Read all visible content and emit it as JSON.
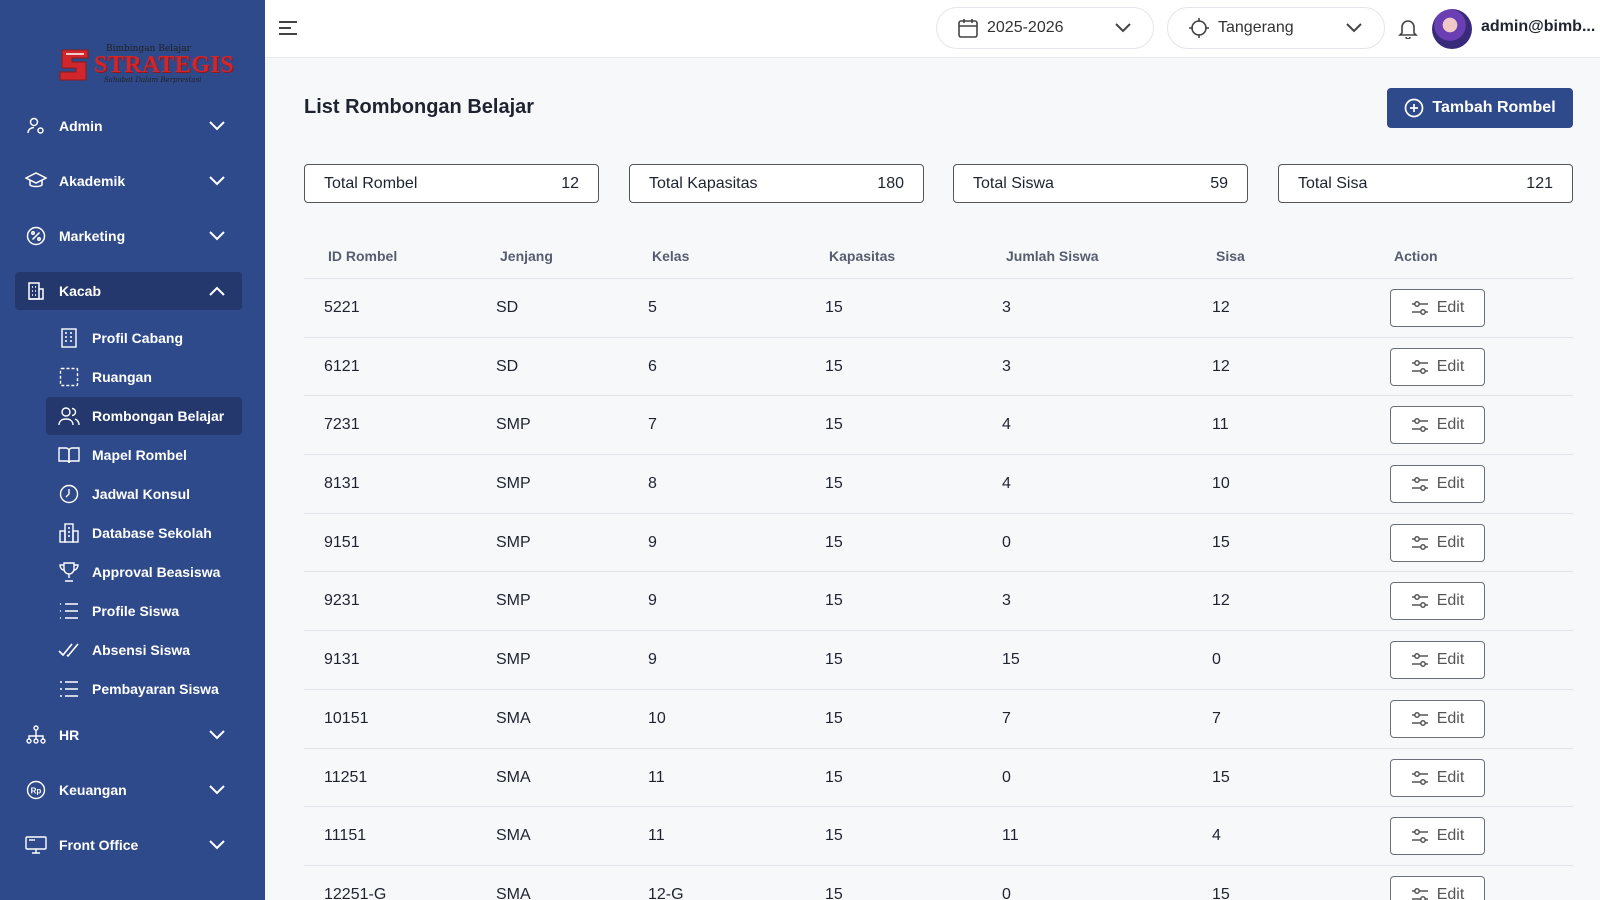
{
  "brand": {
    "tagline": "Bimbingan Belajar",
    "name": "STRATEGIS",
    "slogan": "Sahabat Dalam Berprestasi",
    "colors": {
      "sidebar": "#2f4a8a",
      "active": "#24386d",
      "logo_red": "#d0262c"
    }
  },
  "sidebar": {
    "groups": [
      {
        "label": "Admin",
        "icon": "user-gear-icon",
        "expanded": false
      },
      {
        "label": "Akademik",
        "icon": "graduation-cap-icon",
        "expanded": false
      },
      {
        "label": "Marketing",
        "icon": "percent-badge-icon",
        "expanded": false
      },
      {
        "label": "Kacab",
        "icon": "building-icon",
        "expanded": true
      },
      {
        "label": "HR",
        "icon": "org-chart-icon",
        "expanded": false
      },
      {
        "label": "Keuangan",
        "icon": "rupiah-icon",
        "expanded": false
      },
      {
        "label": "Front Office",
        "icon": "monitor-icon",
        "expanded": false
      }
    ],
    "kacab_items": [
      {
        "label": "Profil Cabang",
        "icon": "building-grid-icon"
      },
      {
        "label": "Ruangan",
        "icon": "dashed-square-icon"
      },
      {
        "label": "Rombongan Belajar",
        "icon": "users-icon",
        "active": true
      },
      {
        "label": "Mapel Rombel",
        "icon": "book-open-icon"
      },
      {
        "label": "Jadwal Konsul",
        "icon": "clock-icon"
      },
      {
        "label": "Database Sekolah",
        "icon": "school-icon"
      },
      {
        "label": "Approval Beasiswa",
        "icon": "trophy-icon"
      },
      {
        "label": "Profile Siswa",
        "icon": "list-icon"
      },
      {
        "label": "Absensi Siswa",
        "icon": "double-check-icon"
      },
      {
        "label": "Pembayaran Siswa",
        "icon": "list-checks-icon"
      }
    ]
  },
  "header": {
    "year": "2025-2026",
    "branch": "Tangerang",
    "user": "admin@bimb..."
  },
  "main": {
    "title": "List Rombongan Belajar",
    "add_button": "Tambah Rombel",
    "stats": [
      {
        "label": "Total Rombel",
        "value": "12"
      },
      {
        "label": "Total Kapasitas",
        "value": "180"
      },
      {
        "label": "Total Siswa",
        "value": "59"
      },
      {
        "label": "Total Sisa",
        "value": "121"
      }
    ],
    "table": {
      "columns": [
        "ID Rombel",
        "Jenjang",
        "Kelas",
        "Kapasitas",
        "Jumlah Siswa",
        "Sisa",
        "Action"
      ],
      "edit_label": "Edit",
      "rows": [
        [
          "5221",
          "SD",
          "5",
          "15",
          "3",
          "12"
        ],
        [
          "6121",
          "SD",
          "6",
          "15",
          "3",
          "12"
        ],
        [
          "7231",
          "SMP",
          "7",
          "15",
          "4",
          "11"
        ],
        [
          "8131",
          "SMP",
          "8",
          "15",
          "4",
          "10"
        ],
        [
          "9151",
          "SMP",
          "9",
          "15",
          "0",
          "15"
        ],
        [
          "9231",
          "SMP",
          "9",
          "15",
          "3",
          "12"
        ],
        [
          "9131",
          "SMP",
          "9",
          "15",
          "15",
          "0"
        ],
        [
          "10151",
          "SMA",
          "10",
          "15",
          "7",
          "7"
        ],
        [
          "11251",
          "SMA",
          "11",
          "15",
          "0",
          "15"
        ],
        [
          "11151",
          "SMA",
          "11",
          "15",
          "11",
          "4"
        ],
        [
          "12251-G",
          "SMA",
          "12-G",
          "15",
          "0",
          "15"
        ]
      ]
    }
  }
}
